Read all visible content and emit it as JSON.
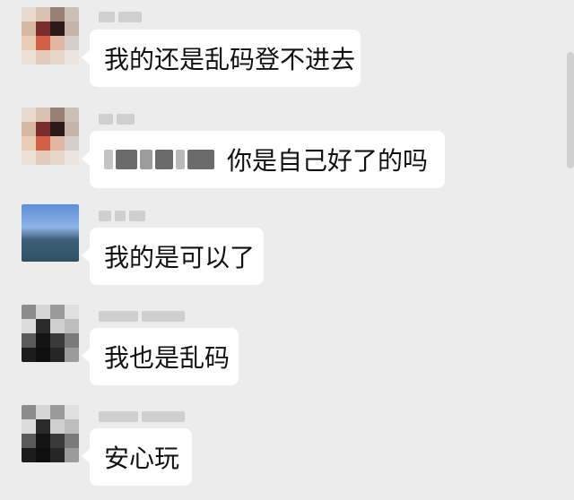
{
  "messages": [
    {
      "text": "我的还是乱码登不进去"
    },
    {
      "quote_note": "blurred quoted name",
      "text": "你是自己好了的吗"
    },
    {
      "text": "我的是可以了"
    },
    {
      "text": "我也是乱码"
    },
    {
      "text": "安心玩"
    }
  ],
  "colors": {
    "background": "#ececec",
    "bubble": "#ffffff",
    "text": "#111111"
  }
}
